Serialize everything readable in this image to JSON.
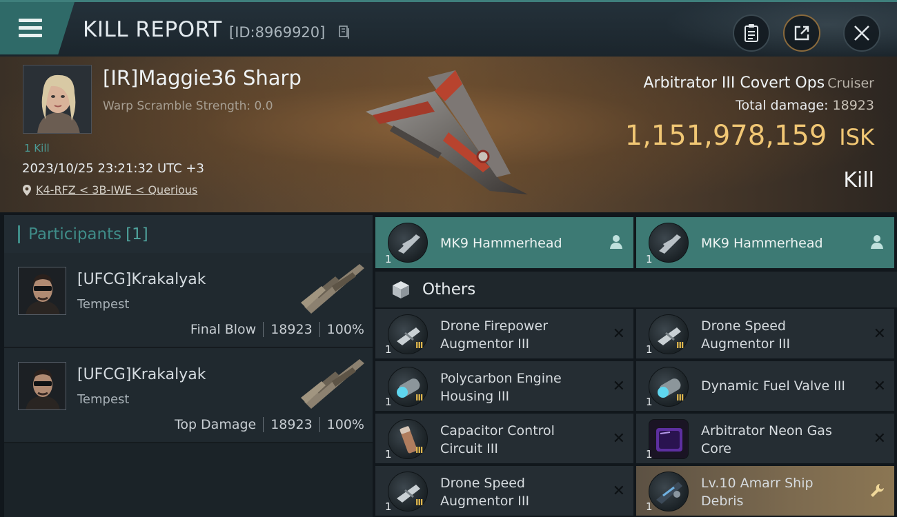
{
  "header": {
    "title": "KILL REPORT",
    "report_id": "[ID:8969920]",
    "icons": [
      "menu-icon",
      "copy-icon",
      "clipboard-icon",
      "share-icon",
      "close-icon"
    ]
  },
  "victim": {
    "name": "[IR]Maggie36 Sharp",
    "warp_scramble": "Warp Scramble Strength: 0.0",
    "kill_count": "1 Kill",
    "datetime": "2023/10/25 23:21:32 UTC +3",
    "location": "K4-RFZ < 3B-IWE < Querious",
    "ship_name": "Arbitrator III Covert Ops",
    "ship_class": "Cruiser",
    "total_damage_label": "Total damage:",
    "total_damage": "18923",
    "isk_value": "1,151,978,159",
    "isk_unit": "ISK",
    "kill_type": "Kill"
  },
  "participants": {
    "label": "Participants",
    "count": "[1]",
    "rows": [
      {
        "name": "[UFCG]Krakalyak",
        "ship": "Tempest",
        "role": "Final Blow",
        "damage": "18923",
        "percent": "100%"
      },
      {
        "name": "[UFCG]Krakalyak",
        "ship": "Tempest",
        "role": "Top Damage",
        "damage": "18923",
        "percent": "100%"
      }
    ]
  },
  "drones": [
    {
      "name": "MK9  Hammerhead",
      "qty": "1"
    },
    {
      "name": "MK9  Hammerhead",
      "qty": "1"
    }
  ],
  "others_label": "Others",
  "items": [
    {
      "name_line1": "Drone Firepower",
      "name_line2": "Augmentor III",
      "qty": "1",
      "tier": "III",
      "status": "destroyed"
    },
    {
      "name_line1": "Drone Speed",
      "name_line2": "Augmentor III",
      "qty": "1",
      "tier": "III",
      "status": "destroyed"
    },
    {
      "name_line1": "Polycarbon Engine",
      "name_line2": "Housing III",
      "qty": "1",
      "tier": "III",
      "status": "destroyed"
    },
    {
      "name_line1": "Dynamic Fuel Valve III",
      "name_line2": "",
      "qty": "1",
      "tier": "III",
      "status": "destroyed"
    },
    {
      "name_line1": "Capacitor Control",
      "name_line2": "Circuit III",
      "qty": "1",
      "tier": "III",
      "status": "destroyed"
    },
    {
      "name_line1": "Arbitrator Neon Gas",
      "name_line2": "Core",
      "qty": "1",
      "tier": "",
      "status": "destroyed"
    },
    {
      "name_line1": "Drone Speed",
      "name_line2": "Augmentor III",
      "qty": "1",
      "tier": "III",
      "status": "destroyed"
    },
    {
      "name_line1": "Lv.10 Amarr Ship",
      "name_line2": "Debris",
      "qty": "1",
      "tier": "",
      "status": "dropped"
    }
  ],
  "colors": {
    "accent_teal": "#3d7a74",
    "isk_gold": "#f1c774",
    "tier_gold": "#e0b74d",
    "debris_gold": "#8b7653"
  }
}
